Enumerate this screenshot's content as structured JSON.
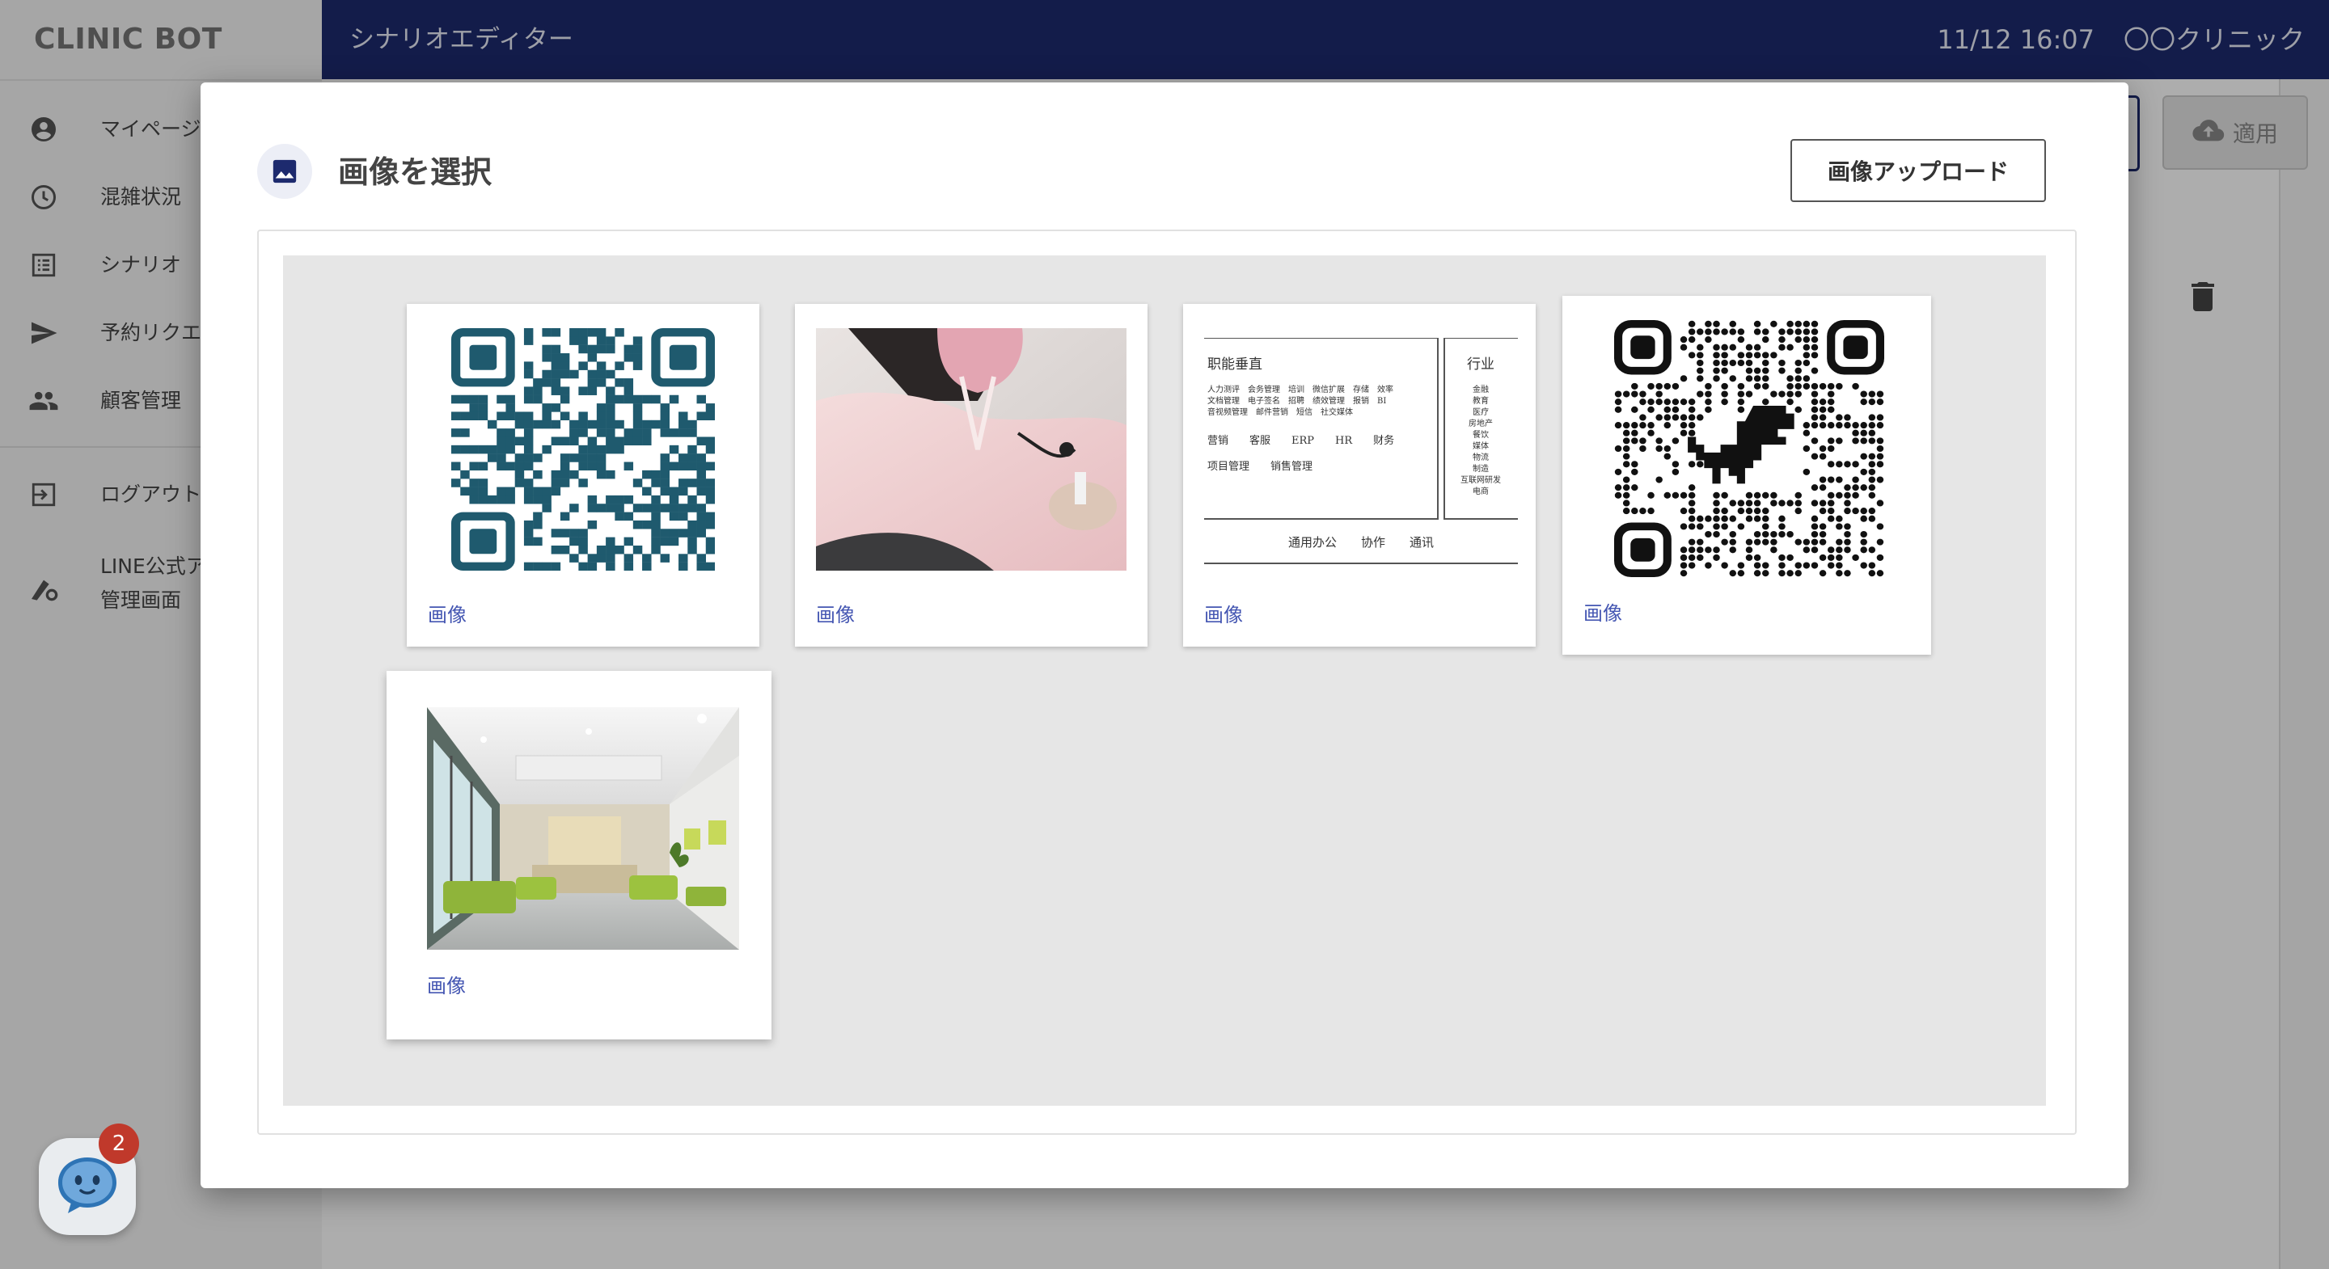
{
  "app": {
    "brand": "CLINIC BOT",
    "screen_title": "シナリオエディター",
    "datetime": "11/12 16:07",
    "clinic_name": "〇〇クリニック"
  },
  "sidebar": {
    "items": [
      {
        "label": "マイページ",
        "icon": "account-circle-icon"
      },
      {
        "label": "混雑状況",
        "icon": "clock-icon"
      },
      {
        "label": "シナリオ",
        "icon": "list-icon"
      },
      {
        "label": "予約リクエ",
        "icon": "send-icon"
      },
      {
        "label": "顧客管理",
        "icon": "people-icon"
      }
    ],
    "secondary": [
      {
        "label": "ログアウト",
        "icon": "logout-icon"
      },
      {
        "label": "LINE公式ア",
        "label2": "管理画面",
        "icon": "admin-settings-icon"
      }
    ]
  },
  "toolbar": {
    "apply_label": "適用"
  },
  "modal": {
    "title": "画像を選択",
    "upload_label": "画像アップロード",
    "images": [
      {
        "caption": "画像",
        "kind": "qr-code",
        "selected": false
      },
      {
        "caption": "画像",
        "kind": "photo-nurse",
        "selected": false
      },
      {
        "caption": "画像",
        "kind": "text-diagram",
        "selected": false
      },
      {
        "caption": "画像",
        "kind": "qr-code-dino",
        "selected": false
      },
      {
        "caption": "画像",
        "kind": "photo-lobby",
        "selected": true
      }
    ],
    "diagram": {
      "left_heading": "职能垂直",
      "left_lines": [
        "人力测评　会务管理　培训　微信扩展　存储　效率",
        "文档管理　电子签名　招聘　绩效管理　报销　BI",
        "音视频管理　邮件营销　短信　社交媒体"
      ],
      "left_row2": "营销　　客服　　ERP　　HR　　财务",
      "left_row3": "项目管理　　销售管理",
      "right_heading": "行业",
      "right_items": [
        "金融",
        "教育",
        "医疗",
        "房地产",
        "餐饮",
        "媒体",
        "物流",
        "制造",
        "互联网研发",
        "电商"
      ],
      "bottom": "通用办公　　协作　　通讯"
    }
  },
  "chat": {
    "badge_count": "2"
  },
  "colors": {
    "topbar": "#1d2a6e",
    "accent_link": "#4456b2",
    "qr_teal": "#1f5a6e",
    "badge": "#c0392b"
  }
}
